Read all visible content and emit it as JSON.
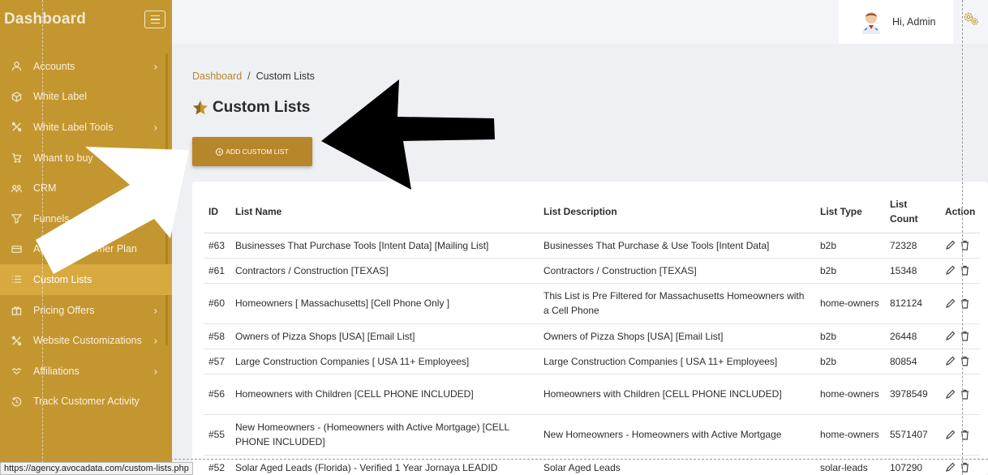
{
  "sidebar": {
    "brand": "Dashboard",
    "items": [
      {
        "label": "Accounts",
        "icon": "user-icon",
        "has_submenu": true
      },
      {
        "label": "White Label",
        "icon": "cube-icon",
        "has_submenu": false
      },
      {
        "label": "White Label Tools",
        "icon": "tools-icon",
        "has_submenu": true
      },
      {
        "label": "Whant to buy",
        "icon": "cart-icon",
        "has_submenu": false
      },
      {
        "label": "CRM",
        "icon": "users-icon",
        "has_submenu": false
      },
      {
        "label": "Funnels",
        "icon": "funnel-icon",
        "has_submenu": false
      },
      {
        "label": "Agency Customer Plan",
        "icon": "card-icon",
        "has_submenu": false
      },
      {
        "label": "Custom Lists",
        "icon": "list-icon",
        "has_submenu": false,
        "active": true
      },
      {
        "label": "Pricing Offers",
        "icon": "gift-icon",
        "has_submenu": true
      },
      {
        "label": "Website Customizations",
        "icon": "tools-icon",
        "has_submenu": true
      },
      {
        "label": "Affiliations",
        "icon": "handshake-icon",
        "has_submenu": true
      },
      {
        "label": "Track Customer Activity",
        "icon": "history-icon",
        "has_submenu": false
      }
    ]
  },
  "header": {
    "greeting": "Hi, Admin"
  },
  "breadcrumb": {
    "home": "Dashboard",
    "separator": "/",
    "current": "Custom Lists"
  },
  "page": {
    "title": "Custom Lists",
    "add_button": "ADD CUSTOM LIST"
  },
  "table": {
    "headers": {
      "id": "ID",
      "name": "List Name",
      "description": "List Description",
      "type": "List Type",
      "count": "List Count",
      "action": "Action"
    },
    "rows": [
      {
        "id": "#63",
        "name": "Businesses That Purchase Tools [Intent Data] [Mailing List]",
        "description": "Businesses That Purchase & Use Tools [Intent Data]",
        "type": "b2b",
        "count": "72328"
      },
      {
        "id": "#61",
        "name": "Contractors / Construction [TEXAS]",
        "description": "Contractors / Construction [TEXAS]",
        "type": "b2b",
        "count": "15348"
      },
      {
        "id": "#60",
        "name": "Homeowners [ Massachusetts] [Cell Phone Only ]",
        "description": "This List is Pre Filtered for Massachusetts Homeowners with a Cell Phone",
        "type": "home-owners",
        "count": "812124"
      },
      {
        "id": "#58",
        "name": "Owners of Pizza Shops [USA] [Email List]",
        "description": "Owners of Pizza Shops [USA] [Email List]",
        "type": "b2b",
        "count": "26448"
      },
      {
        "id": "#57",
        "name": "Large Construction Companies [ USA 11+ Employees]",
        "description": "Large Construction Companies [ USA 11+ Employees]",
        "type": "b2b",
        "count": "80854"
      },
      {
        "id": "#56",
        "name": "Homeowners with Children [CELL PHONE INCLUDED]",
        "description": "Homeowners with Children [CELL PHONE INCLUDED]",
        "type": "home-owners",
        "count": "3978549"
      },
      {
        "id": "#55",
        "name": "New Homeowners - (Homeowners with Active Mortgage) [CELL PHONE INCLUDED]",
        "description": "New Homeowners - Homeowners with Active Mortgage",
        "type": "home-owners",
        "count": "5571407"
      },
      {
        "id": "#52",
        "name": "Solar Aged Leads (Florida) - Verified 1 Year Jornaya LEADID",
        "description": "Solar Aged Leads",
        "type": "solar-leads",
        "count": "107290"
      }
    ]
  },
  "status_bar": {
    "url": "https://agency.avocadata.com/custom-lists.php"
  },
  "colors": {
    "sidebar": "#c4962f",
    "active_item": "#d8a93f",
    "accent": "#b8862a"
  }
}
